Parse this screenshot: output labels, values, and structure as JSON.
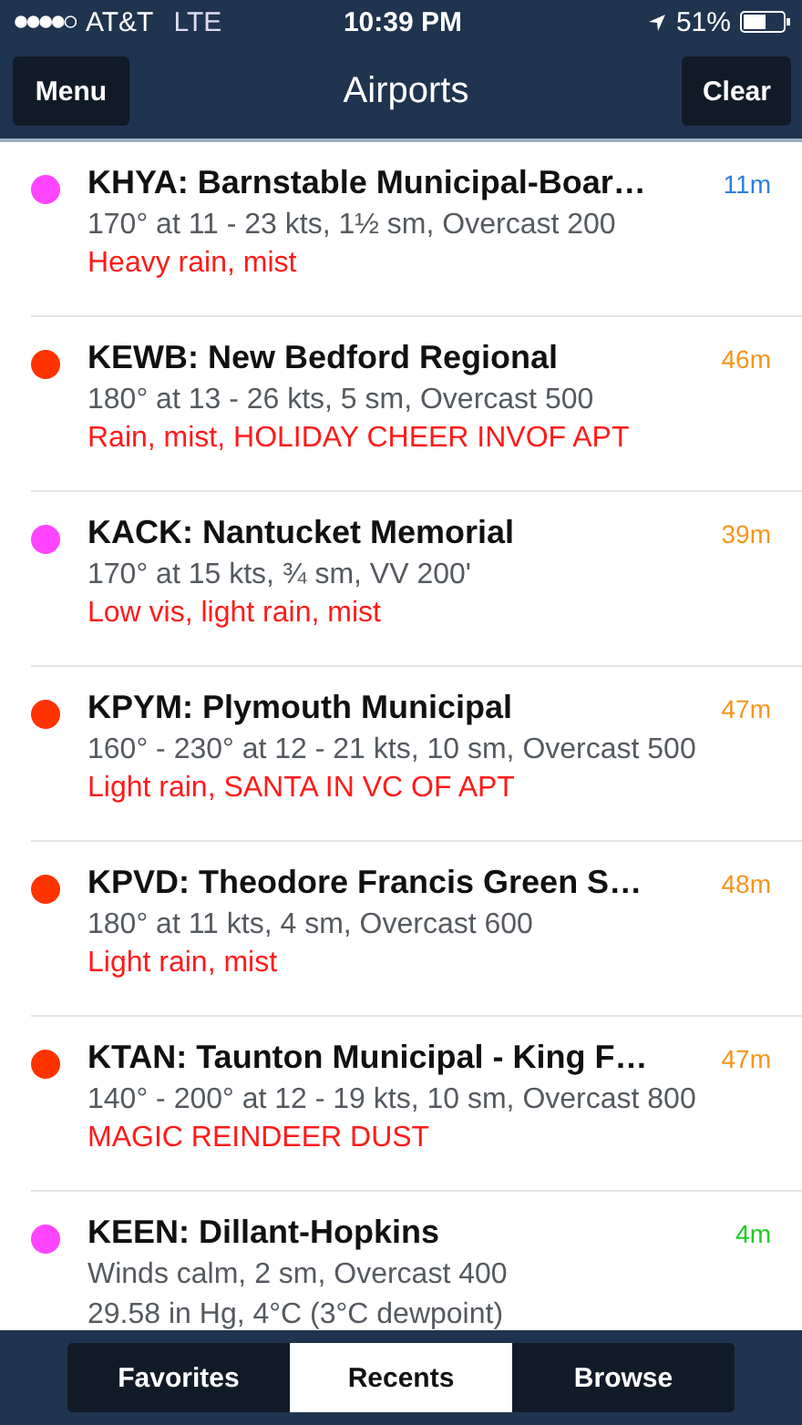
{
  "status_bar": {
    "carrier": "AT&T",
    "network": "LTE",
    "time": "10:39 PM",
    "battery": "51%"
  },
  "nav": {
    "left": "Menu",
    "title": "Airports",
    "right": "Clear"
  },
  "airports": [
    {
      "title": "KHYA: Barnstable Municipal-Boar…",
      "age": {
        "text": "11m",
        "color": "#2a7fe0"
      },
      "color": "#ff44ff",
      "details": [
        "170° at 11 - 23 kts, 1½ sm, Overcast 200"
      ],
      "weather": "Heavy rain, mist"
    },
    {
      "title": "KEWB: New Bedford Regional",
      "age": {
        "text": "46m",
        "color": "#f7941d"
      },
      "color": "#ff3300",
      "details": [
        "180° at 13 - 26 kts, 5 sm, Overcast 500"
      ],
      "weather": "Rain, mist, HOLIDAY CHEER INVOF APT"
    },
    {
      "title": "KACK: Nantucket Memorial",
      "age": {
        "text": "39m",
        "color": "#f7941d"
      },
      "color": "#ff44ff",
      "details": [
        "170° at 15 kts, ¾ sm, VV 200'"
      ],
      "weather": "Low vis, light rain, mist"
    },
    {
      "title": "KPYM: Plymouth Municipal",
      "age": {
        "text": "47m",
        "color": "#f7941d"
      },
      "color": "#ff3300",
      "details": [
        "160° - 230° at 12 - 21 kts, 10 sm, Overcast 500"
      ],
      "weather": "Light rain, SANTA IN VC OF APT"
    },
    {
      "title": "KPVD: Theodore Francis Green S…",
      "age": {
        "text": "48m",
        "color": "#f7941d"
      },
      "color": "#ff3300",
      "details": [
        "180° at 11 kts, 4 sm, Overcast 600"
      ],
      "weather": "Light rain, mist"
    },
    {
      "title": "KTAN: Taunton Municipal - King F…",
      "age": {
        "text": "47m",
        "color": "#f7941d"
      },
      "color": "#ff3300",
      "details": [
        "140° - 200° at 12 - 19 kts, 10 sm, Overcast 800"
      ],
      "weather": "MAGIC REINDEER DUST"
    },
    {
      "title": "KEEN: Dillant-Hopkins",
      "age": {
        "text": "4m",
        "color": "#22cc22"
      },
      "color": "#ff44ff",
      "details": [
        "Winds calm, 2 sm, Overcast 400",
        "29.58 in Hg, 4°C (3°C dewpoint)"
      ]
    }
  ],
  "tabs": [
    {
      "label": "Favorites",
      "selected": false
    },
    {
      "label": "Recents",
      "selected": true
    },
    {
      "label": "Browse",
      "selected": false
    }
  ]
}
